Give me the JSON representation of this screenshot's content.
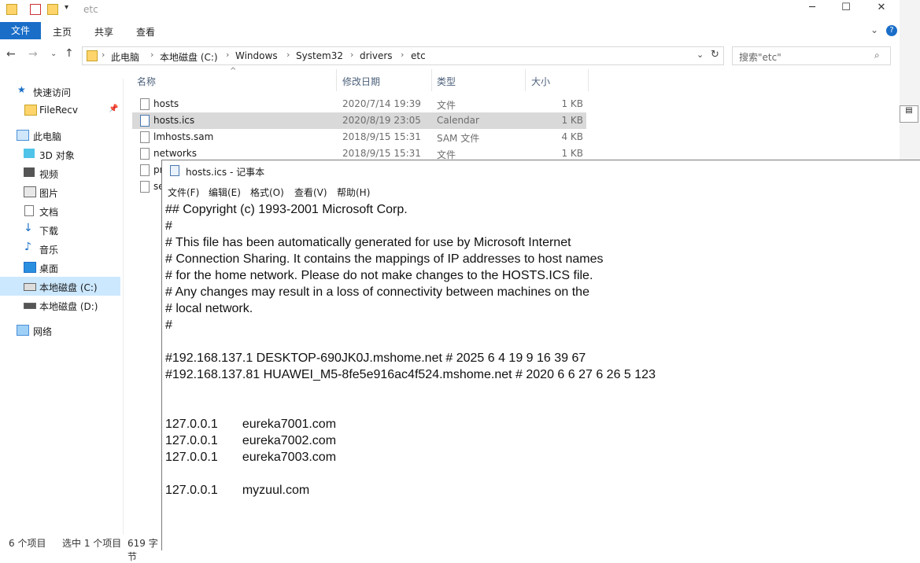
{
  "explorer": {
    "window_title": "etc",
    "ribbon_tabs": [
      "文件",
      "主页",
      "共享",
      "查看"
    ],
    "breadcrumb": [
      "此电脑",
      "本地磁盘 (C:)",
      "Windows",
      "System32",
      "drivers",
      "etc"
    ],
    "search_placeholder": "搜索\"etc\"",
    "columns": {
      "name": "名称",
      "date": "修改日期",
      "type": "类型",
      "size": "大小"
    },
    "files": [
      {
        "name": "hosts",
        "date": "2020/7/14 19:39",
        "type": "文件",
        "size": "1 KB",
        "selected": false
      },
      {
        "name": "hosts.ics",
        "date": "2020/8/19 23:05",
        "type": "Calendar",
        "size": "1 KB",
        "selected": true
      },
      {
        "name": "lmhosts.sam",
        "date": "2018/9/15 15:31",
        "type": "SAM 文件",
        "size": "4 KB",
        "selected": false
      },
      {
        "name": "networks",
        "date": "2018/9/15 15:31",
        "type": "文件",
        "size": "1 KB",
        "selected": false
      },
      {
        "name": "pr",
        "date": "",
        "type": "",
        "size": "",
        "selected": false
      },
      {
        "name": "se",
        "date": "",
        "type": "",
        "size": "",
        "selected": false
      }
    ],
    "nav": [
      {
        "label": "快速访问",
        "icon": "star-icon"
      },
      {
        "label": "FileRecv",
        "icon": "folder-icon"
      },
      {
        "label": "此电脑",
        "icon": "computer-icon"
      },
      {
        "label": "3D 对象",
        "icon": "cube-icon"
      },
      {
        "label": "视频",
        "icon": "video-icon"
      },
      {
        "label": "图片",
        "icon": "picture-icon"
      },
      {
        "label": "文档",
        "icon": "document-icon"
      },
      {
        "label": "下载",
        "icon": "download-icon"
      },
      {
        "label": "音乐",
        "icon": "music-icon"
      },
      {
        "label": "桌面",
        "icon": "desktop-icon"
      },
      {
        "label": "本地磁盘 (C:)",
        "icon": "drive-icon"
      },
      {
        "label": "本地磁盘 (D:)",
        "icon": "drive-icon"
      },
      {
        "label": "网络",
        "icon": "network-icon"
      }
    ],
    "status": {
      "count": "6 个项目",
      "selected": "选中 1 个项目",
      "size": "619 字节"
    }
  },
  "notepad": {
    "title": "hosts.ics - 记事本",
    "menu": [
      "文件(F)",
      "编辑(E)",
      "格式(O)",
      "查看(V)",
      "帮助(H)"
    ],
    "lines": [
      "## Copyright (c) 1993-2001 Microsoft Corp.",
      "#",
      "# This file has been automatically generated for use by Microsoft Internet",
      "# Connection Sharing. It contains the mappings of IP addresses to host names",
      "# for the home network. Please do not make changes to the HOSTS.ICS file.",
      "# Any changes may result in a loss of connectivity between machines on the",
      "# local network.",
      "#",
      "",
      "#192.168.137.1 DESKTOP-690JK0J.mshome.net # 2025 6 4 19 9 16 39 67",
      "#192.168.137.81 HUAWEI_M5-8fe5e916ac4f524.mshome.net # 2020 6 6 27 6 26 5 123",
      "",
      "",
      "127.0.0.1       eureka7001.com",
      "127.0.0.1       eureka7002.com",
      "127.0.0.1       eureka7003.com",
      "",
      "127.0.0.1       myzuul.com"
    ]
  },
  "colors": {
    "accent": "#1a6ec8",
    "selection": "#d9d9d9",
    "nav_selection": "#cce8ff"
  }
}
